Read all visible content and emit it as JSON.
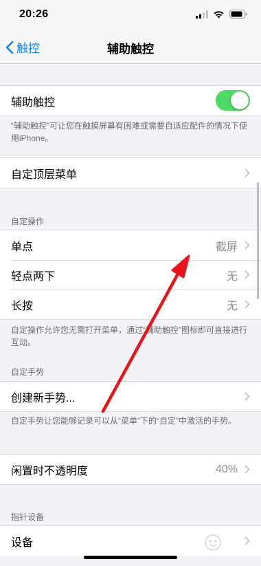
{
  "status_bar": {
    "time": "20:26"
  },
  "nav": {
    "back_label": "触控",
    "title": "辅助触控"
  },
  "assistive_touch": {
    "label": "辅助触控",
    "enabled": true,
    "footer": "“辅助触控”可让您在触摸屏幕有困难或需要自适应配件的情况下使用iPhone。"
  },
  "top_menu": {
    "label": "自定顶层菜单"
  },
  "custom_actions": {
    "header": "自定操作",
    "rows": [
      {
        "label": "单点",
        "value": "截屏"
      },
      {
        "label": "轻点两下",
        "value": "无"
      },
      {
        "label": "长按",
        "value": "无"
      }
    ],
    "footer": "自定操作允许您无需打开菜单，通过“辅助触控”图标即可直接进行互动。"
  },
  "custom_gestures": {
    "header": "自定手势",
    "create_label": "创建新手势...",
    "footer": "自定手势让您能够记录可以从“菜单”下的“自定”中激活的手势。"
  },
  "idle_opacity": {
    "label": "闲置时不透明度",
    "value": "40%"
  },
  "pointer_devices": {
    "header": "指针设备",
    "devices_label": "设备"
  },
  "colors": {
    "accent": "#0a84ff",
    "toggle_on": "#4cd964",
    "annotation_arrow": "#e8141a"
  }
}
